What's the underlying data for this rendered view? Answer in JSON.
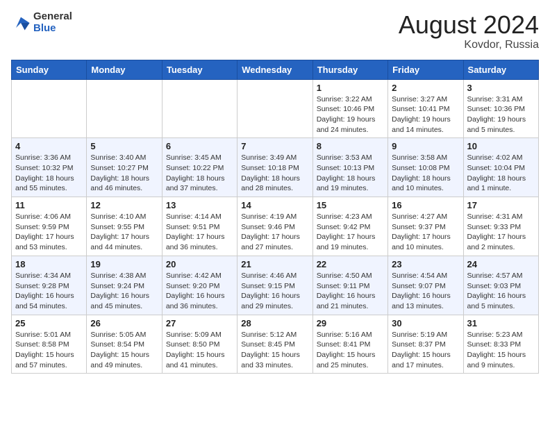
{
  "logo": {
    "general": "General",
    "blue": "Blue"
  },
  "title": {
    "month_year": "August 2024",
    "location": "Kovdor, Russia"
  },
  "days_of_week": [
    "Sunday",
    "Monday",
    "Tuesday",
    "Wednesday",
    "Thursday",
    "Friday",
    "Saturday"
  ],
  "weeks": [
    [
      {
        "num": "",
        "sunrise": "",
        "sunset": "",
        "daylight": ""
      },
      {
        "num": "",
        "sunrise": "",
        "sunset": "",
        "daylight": ""
      },
      {
        "num": "",
        "sunrise": "",
        "sunset": "",
        "daylight": ""
      },
      {
        "num": "",
        "sunrise": "",
        "sunset": "",
        "daylight": ""
      },
      {
        "num": "1",
        "sunrise": "3:22 AM",
        "sunset": "10:46 PM",
        "daylight": "19 hours and 24 minutes."
      },
      {
        "num": "2",
        "sunrise": "3:27 AM",
        "sunset": "10:41 PM",
        "daylight": "19 hours and 14 minutes."
      },
      {
        "num": "3",
        "sunrise": "3:31 AM",
        "sunset": "10:36 PM",
        "daylight": "19 hours and 5 minutes."
      }
    ],
    [
      {
        "num": "4",
        "sunrise": "3:36 AM",
        "sunset": "10:32 PM",
        "daylight": "18 hours and 55 minutes."
      },
      {
        "num": "5",
        "sunrise": "3:40 AM",
        "sunset": "10:27 PM",
        "daylight": "18 hours and 46 minutes."
      },
      {
        "num": "6",
        "sunrise": "3:45 AM",
        "sunset": "10:22 PM",
        "daylight": "18 hours and 37 minutes."
      },
      {
        "num": "7",
        "sunrise": "3:49 AM",
        "sunset": "10:18 PM",
        "daylight": "18 hours and 28 minutes."
      },
      {
        "num": "8",
        "sunrise": "3:53 AM",
        "sunset": "10:13 PM",
        "daylight": "18 hours and 19 minutes."
      },
      {
        "num": "9",
        "sunrise": "3:58 AM",
        "sunset": "10:08 PM",
        "daylight": "18 hours and 10 minutes."
      },
      {
        "num": "10",
        "sunrise": "4:02 AM",
        "sunset": "10:04 PM",
        "daylight": "18 hours and 1 minute."
      }
    ],
    [
      {
        "num": "11",
        "sunrise": "4:06 AM",
        "sunset": "9:59 PM",
        "daylight": "17 hours and 53 minutes."
      },
      {
        "num": "12",
        "sunrise": "4:10 AM",
        "sunset": "9:55 PM",
        "daylight": "17 hours and 44 minutes."
      },
      {
        "num": "13",
        "sunrise": "4:14 AM",
        "sunset": "9:51 PM",
        "daylight": "17 hours and 36 minutes."
      },
      {
        "num": "14",
        "sunrise": "4:19 AM",
        "sunset": "9:46 PM",
        "daylight": "17 hours and 27 minutes."
      },
      {
        "num": "15",
        "sunrise": "4:23 AM",
        "sunset": "9:42 PM",
        "daylight": "17 hours and 19 minutes."
      },
      {
        "num": "16",
        "sunrise": "4:27 AM",
        "sunset": "9:37 PM",
        "daylight": "17 hours and 10 minutes."
      },
      {
        "num": "17",
        "sunrise": "4:31 AM",
        "sunset": "9:33 PM",
        "daylight": "17 hours and 2 minutes."
      }
    ],
    [
      {
        "num": "18",
        "sunrise": "4:34 AM",
        "sunset": "9:28 PM",
        "daylight": "16 hours and 54 minutes."
      },
      {
        "num": "19",
        "sunrise": "4:38 AM",
        "sunset": "9:24 PM",
        "daylight": "16 hours and 45 minutes."
      },
      {
        "num": "20",
        "sunrise": "4:42 AM",
        "sunset": "9:20 PM",
        "daylight": "16 hours and 36 minutes."
      },
      {
        "num": "21",
        "sunrise": "4:46 AM",
        "sunset": "9:15 PM",
        "daylight": "16 hours and 29 minutes."
      },
      {
        "num": "22",
        "sunrise": "4:50 AM",
        "sunset": "9:11 PM",
        "daylight": "16 hours and 21 minutes."
      },
      {
        "num": "23",
        "sunrise": "4:54 AM",
        "sunset": "9:07 PM",
        "daylight": "16 hours and 13 minutes."
      },
      {
        "num": "24",
        "sunrise": "4:57 AM",
        "sunset": "9:03 PM",
        "daylight": "16 hours and 5 minutes."
      }
    ],
    [
      {
        "num": "25",
        "sunrise": "5:01 AM",
        "sunset": "8:58 PM",
        "daylight": "15 hours and 57 minutes."
      },
      {
        "num": "26",
        "sunrise": "5:05 AM",
        "sunset": "8:54 PM",
        "daylight": "15 hours and 49 minutes."
      },
      {
        "num": "27",
        "sunrise": "5:09 AM",
        "sunset": "8:50 PM",
        "daylight": "15 hours and 41 minutes."
      },
      {
        "num": "28",
        "sunrise": "5:12 AM",
        "sunset": "8:45 PM",
        "daylight": "15 hours and 33 minutes."
      },
      {
        "num": "29",
        "sunrise": "5:16 AM",
        "sunset": "8:41 PM",
        "daylight": "15 hours and 25 minutes."
      },
      {
        "num": "30",
        "sunrise": "5:19 AM",
        "sunset": "8:37 PM",
        "daylight": "15 hours and 17 minutes."
      },
      {
        "num": "31",
        "sunrise": "5:23 AM",
        "sunset": "8:33 PM",
        "daylight": "15 hours and 9 minutes."
      }
    ]
  ]
}
